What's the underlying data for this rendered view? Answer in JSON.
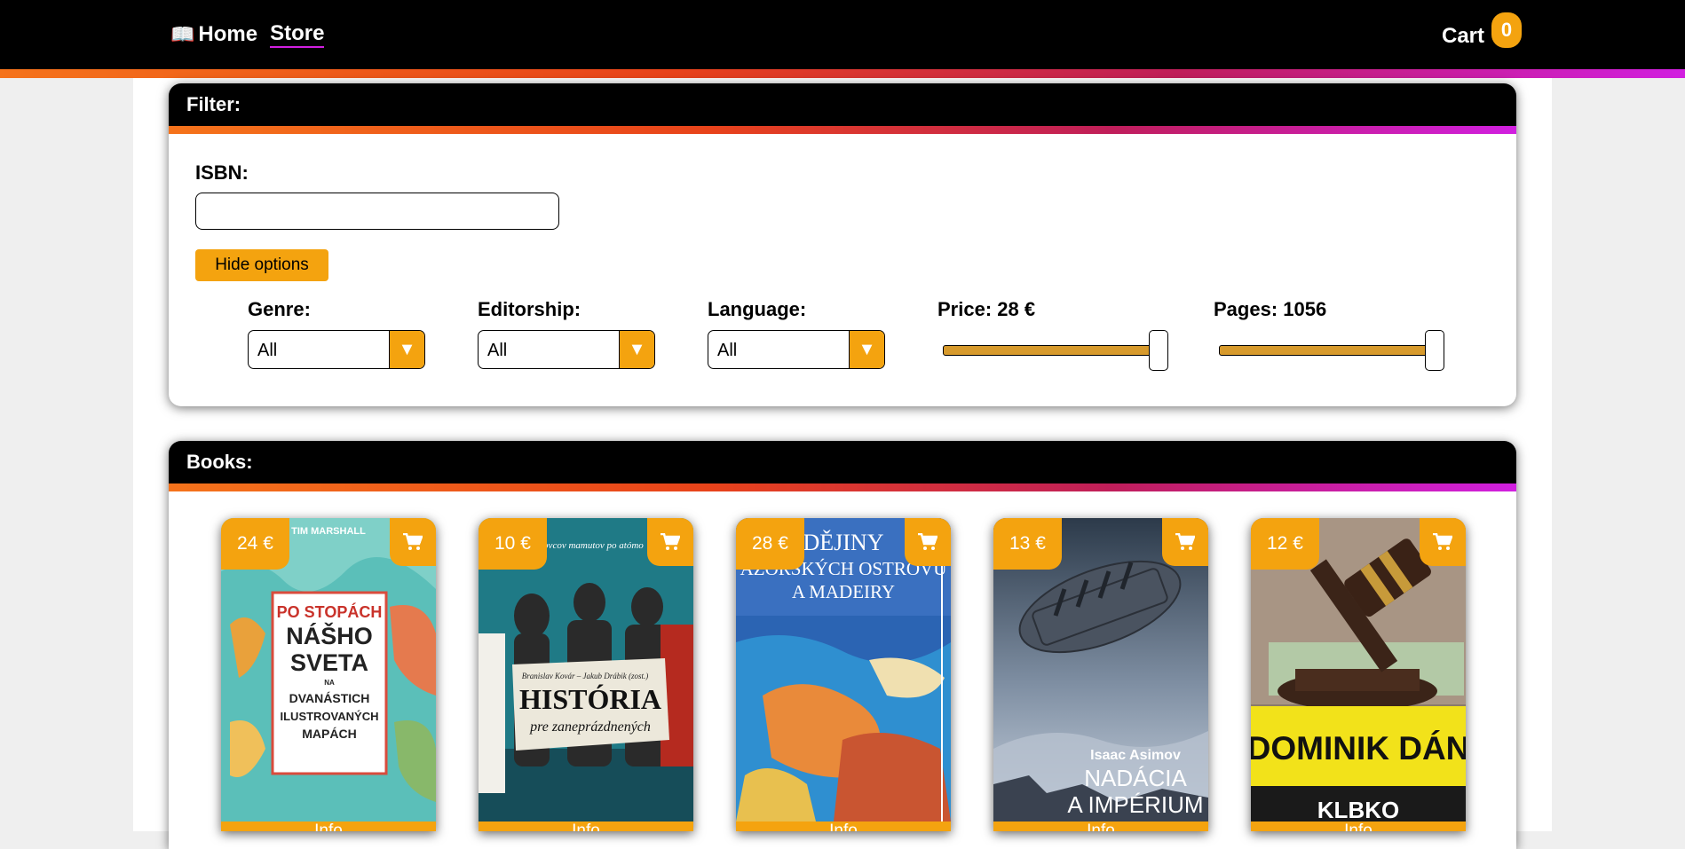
{
  "nav": {
    "home_icon": "book-icon",
    "home_label": "Home",
    "store_label": "Store",
    "cart_label": "Cart",
    "cart_count": "0"
  },
  "filter": {
    "title": "Filter:",
    "isbn_label": "ISBN:",
    "isbn_value": "",
    "hide_options_label": "Hide options",
    "genre_label": "Genre:",
    "genre_value": "All",
    "editorship_label": "Editorship:",
    "editorship_value": "All",
    "language_label": "Language:",
    "language_value": "All",
    "price_label": "Price: 28 €",
    "price_level": 1.0,
    "pages_label": "Pages: 1056",
    "pages_level": 1.0
  },
  "books": {
    "title": "Books:",
    "items": [
      {
        "price": "24 €",
        "info_label": "Info",
        "cover_text": [
          "TIM MARSHALL",
          "PO STOPÁCH",
          "NÁŠHO",
          "SVETA",
          "NA",
          "DVANÁSTICH",
          "ILUSTROVANÝCH",
          "MAPÁCH"
        ]
      },
      {
        "price": "10 €",
        "info_label": "Info",
        "cover_text": [
          "lovcov mamutov po atómo",
          "Branislav Kovár – Jakub Drábik (zost.)",
          "HISTÓRIA",
          "pre zaneprázdnených"
        ]
      },
      {
        "price": "28 €",
        "info_label": "Info",
        "cover_text": [
          "DĚJINY",
          "AZORSKÝCH OSTROVŮ",
          "A MADEIRY"
        ]
      },
      {
        "price": "13 €",
        "info_label": "Info",
        "cover_text": [
          "Isaac Asimov",
          "NADÁCIA",
          "A IMPÉRIUM"
        ]
      },
      {
        "price": "12 €",
        "info_label": "Info",
        "cover_text": [
          "DOMINIK DÁN",
          "KLBKO"
        ]
      }
    ]
  },
  "colors": {
    "accent": "#f4a30f",
    "gradient_start": "#f5731b",
    "gradient_end": "#d11fe0"
  }
}
